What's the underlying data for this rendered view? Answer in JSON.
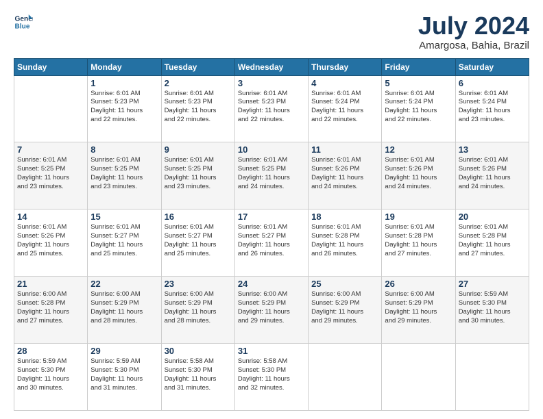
{
  "header": {
    "logo_line1": "General",
    "logo_line2": "Blue",
    "month_title": "July 2024",
    "subtitle": "Amargosa, Bahia, Brazil"
  },
  "days_of_week": [
    "Sunday",
    "Monday",
    "Tuesday",
    "Wednesday",
    "Thursday",
    "Friday",
    "Saturday"
  ],
  "weeks": [
    [
      {
        "day": "",
        "content": ""
      },
      {
        "day": "1",
        "content": "Sunrise: 6:01 AM\nSunset: 5:23 PM\nDaylight: 11 hours\nand 22 minutes."
      },
      {
        "day": "2",
        "content": "Sunrise: 6:01 AM\nSunset: 5:23 PM\nDaylight: 11 hours\nand 22 minutes."
      },
      {
        "day": "3",
        "content": "Sunrise: 6:01 AM\nSunset: 5:23 PM\nDaylight: 11 hours\nand 22 minutes."
      },
      {
        "day": "4",
        "content": "Sunrise: 6:01 AM\nSunset: 5:24 PM\nDaylight: 11 hours\nand 22 minutes."
      },
      {
        "day": "5",
        "content": "Sunrise: 6:01 AM\nSunset: 5:24 PM\nDaylight: 11 hours\nand 22 minutes."
      },
      {
        "day": "6",
        "content": "Sunrise: 6:01 AM\nSunset: 5:24 PM\nDaylight: 11 hours\nand 23 minutes."
      }
    ],
    [
      {
        "day": "7",
        "content": "Sunrise: 6:01 AM\nSunset: 5:25 PM\nDaylight: 11 hours\nand 23 minutes."
      },
      {
        "day": "8",
        "content": "Sunrise: 6:01 AM\nSunset: 5:25 PM\nDaylight: 11 hours\nand 23 minutes."
      },
      {
        "day": "9",
        "content": "Sunrise: 6:01 AM\nSunset: 5:25 PM\nDaylight: 11 hours\nand 23 minutes."
      },
      {
        "day": "10",
        "content": "Sunrise: 6:01 AM\nSunset: 5:25 PM\nDaylight: 11 hours\nand 24 minutes."
      },
      {
        "day": "11",
        "content": "Sunrise: 6:01 AM\nSunset: 5:26 PM\nDaylight: 11 hours\nand 24 minutes."
      },
      {
        "day": "12",
        "content": "Sunrise: 6:01 AM\nSunset: 5:26 PM\nDaylight: 11 hours\nand 24 minutes."
      },
      {
        "day": "13",
        "content": "Sunrise: 6:01 AM\nSunset: 5:26 PM\nDaylight: 11 hours\nand 24 minutes."
      }
    ],
    [
      {
        "day": "14",
        "content": "Sunrise: 6:01 AM\nSunset: 5:26 PM\nDaylight: 11 hours\nand 25 minutes."
      },
      {
        "day": "15",
        "content": "Sunrise: 6:01 AM\nSunset: 5:27 PM\nDaylight: 11 hours\nand 25 minutes."
      },
      {
        "day": "16",
        "content": "Sunrise: 6:01 AM\nSunset: 5:27 PM\nDaylight: 11 hours\nand 25 minutes."
      },
      {
        "day": "17",
        "content": "Sunrise: 6:01 AM\nSunset: 5:27 PM\nDaylight: 11 hours\nand 26 minutes."
      },
      {
        "day": "18",
        "content": "Sunrise: 6:01 AM\nSunset: 5:28 PM\nDaylight: 11 hours\nand 26 minutes."
      },
      {
        "day": "19",
        "content": "Sunrise: 6:01 AM\nSunset: 5:28 PM\nDaylight: 11 hours\nand 27 minutes."
      },
      {
        "day": "20",
        "content": "Sunrise: 6:01 AM\nSunset: 5:28 PM\nDaylight: 11 hours\nand 27 minutes."
      }
    ],
    [
      {
        "day": "21",
        "content": "Sunrise: 6:00 AM\nSunset: 5:28 PM\nDaylight: 11 hours\nand 27 minutes."
      },
      {
        "day": "22",
        "content": "Sunrise: 6:00 AM\nSunset: 5:29 PM\nDaylight: 11 hours\nand 28 minutes."
      },
      {
        "day": "23",
        "content": "Sunrise: 6:00 AM\nSunset: 5:29 PM\nDaylight: 11 hours\nand 28 minutes."
      },
      {
        "day": "24",
        "content": "Sunrise: 6:00 AM\nSunset: 5:29 PM\nDaylight: 11 hours\nand 29 minutes."
      },
      {
        "day": "25",
        "content": "Sunrise: 6:00 AM\nSunset: 5:29 PM\nDaylight: 11 hours\nand 29 minutes."
      },
      {
        "day": "26",
        "content": "Sunrise: 6:00 AM\nSunset: 5:29 PM\nDaylight: 11 hours\nand 29 minutes."
      },
      {
        "day": "27",
        "content": "Sunrise: 5:59 AM\nSunset: 5:30 PM\nDaylight: 11 hours\nand 30 minutes."
      }
    ],
    [
      {
        "day": "28",
        "content": "Sunrise: 5:59 AM\nSunset: 5:30 PM\nDaylight: 11 hours\nand 30 minutes."
      },
      {
        "day": "29",
        "content": "Sunrise: 5:59 AM\nSunset: 5:30 PM\nDaylight: 11 hours\nand 31 minutes."
      },
      {
        "day": "30",
        "content": "Sunrise: 5:58 AM\nSunset: 5:30 PM\nDaylight: 11 hours\nand 31 minutes."
      },
      {
        "day": "31",
        "content": "Sunrise: 5:58 AM\nSunset: 5:30 PM\nDaylight: 11 hours\nand 32 minutes."
      },
      {
        "day": "",
        "content": ""
      },
      {
        "day": "",
        "content": ""
      },
      {
        "day": "",
        "content": ""
      }
    ]
  ]
}
